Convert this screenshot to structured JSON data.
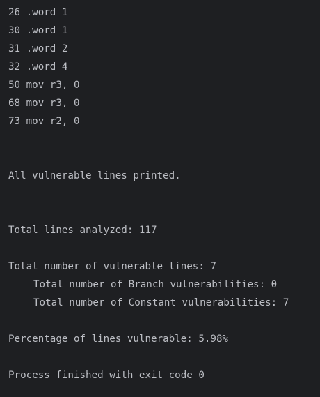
{
  "console": {
    "vulnerable_lines": [
      "26 .word 1",
      "30 .word 1",
      "31 .word 2",
      "32 .word 4",
      "50 mov r3, 0",
      "68 mov r3, 0",
      "73 mov r2, 0"
    ],
    "all_printed": "All vulnerable lines printed.",
    "total_lines": "Total lines analyzed: 117",
    "total_vulnerable": "Total number of vulnerable lines: 7",
    "branch_vulnerabilities": "Total number of Branch vulnerabilities: 0",
    "constant_vulnerabilities": "Total number of Constant vulnerabilities: 7",
    "percentage": "Percentage of lines vulnerable: 5.98%",
    "exit_message": "Process finished with exit code 0"
  }
}
